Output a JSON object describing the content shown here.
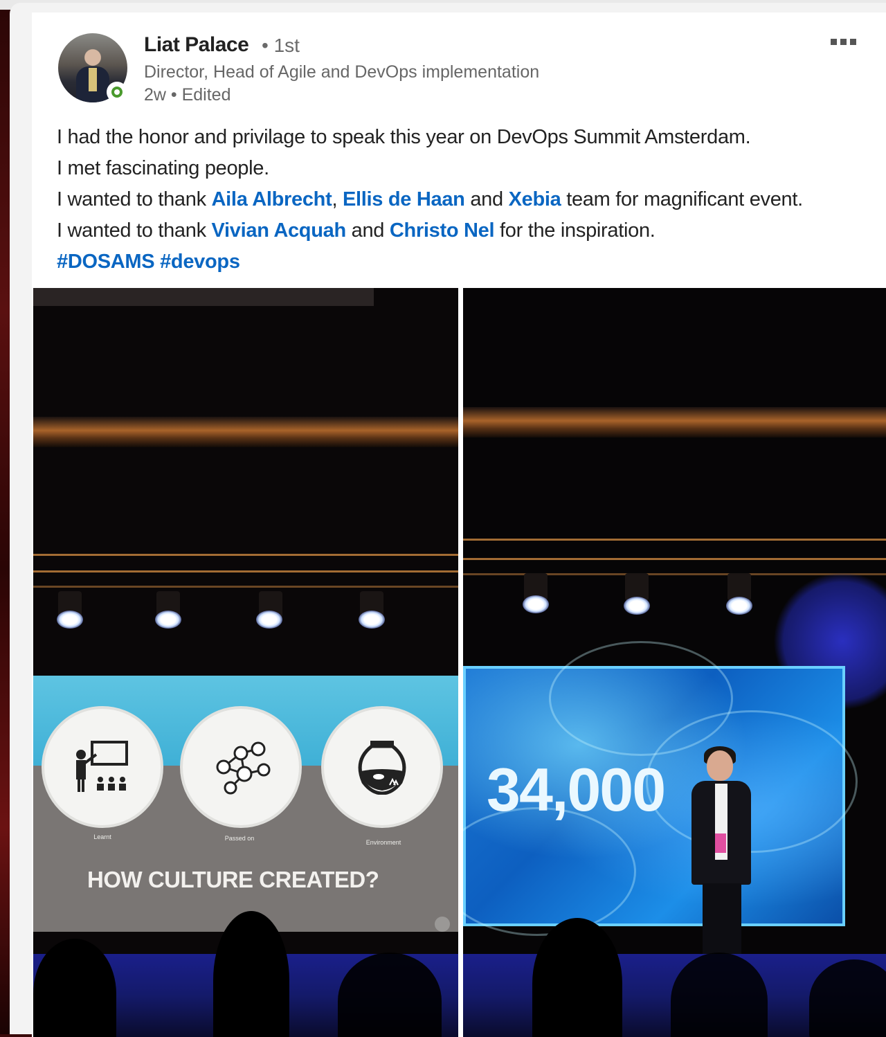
{
  "post": {
    "author": {
      "name": "Liat Palace",
      "degree": "• 1st",
      "headline": "Director, Head of Agile and DevOps implementation",
      "meta": "2w • Edited"
    },
    "more_icon": "ellipsis-icon",
    "lines": {
      "l1": "I had the honor and privilage to speak this year on DevOps Summit Amsterdam.",
      "l2": "I met fascinating people.",
      "l3_a": "I wanted to thank ",
      "l3_link1": "Aila Albrecht",
      "l3_b": ", ",
      "l3_link2": "Ellis de Haan",
      "l3_c": " and ",
      "l3_link3": "Xebia",
      "l3_d": " team for magnificant event.",
      "l4_a": "I wanted to thank ",
      "l4_link1": "Vivian Acquah",
      "l4_b": " and ",
      "l4_link2": "Christo Nel",
      "l4_c": " for the inspiration.",
      "hashtag1": "#DOSAMS",
      "hashtag2": "#devops"
    },
    "photo_left": {
      "slide_captions": [
        "Learnt",
        "Passed on",
        "Environment"
      ],
      "slide_title": "HOW CULTURE CREATED?"
    },
    "photo_right": {
      "slide_number": "34,000"
    },
    "colors": {
      "link": "#0a66c2",
      "online": "#4a9a2d"
    }
  }
}
